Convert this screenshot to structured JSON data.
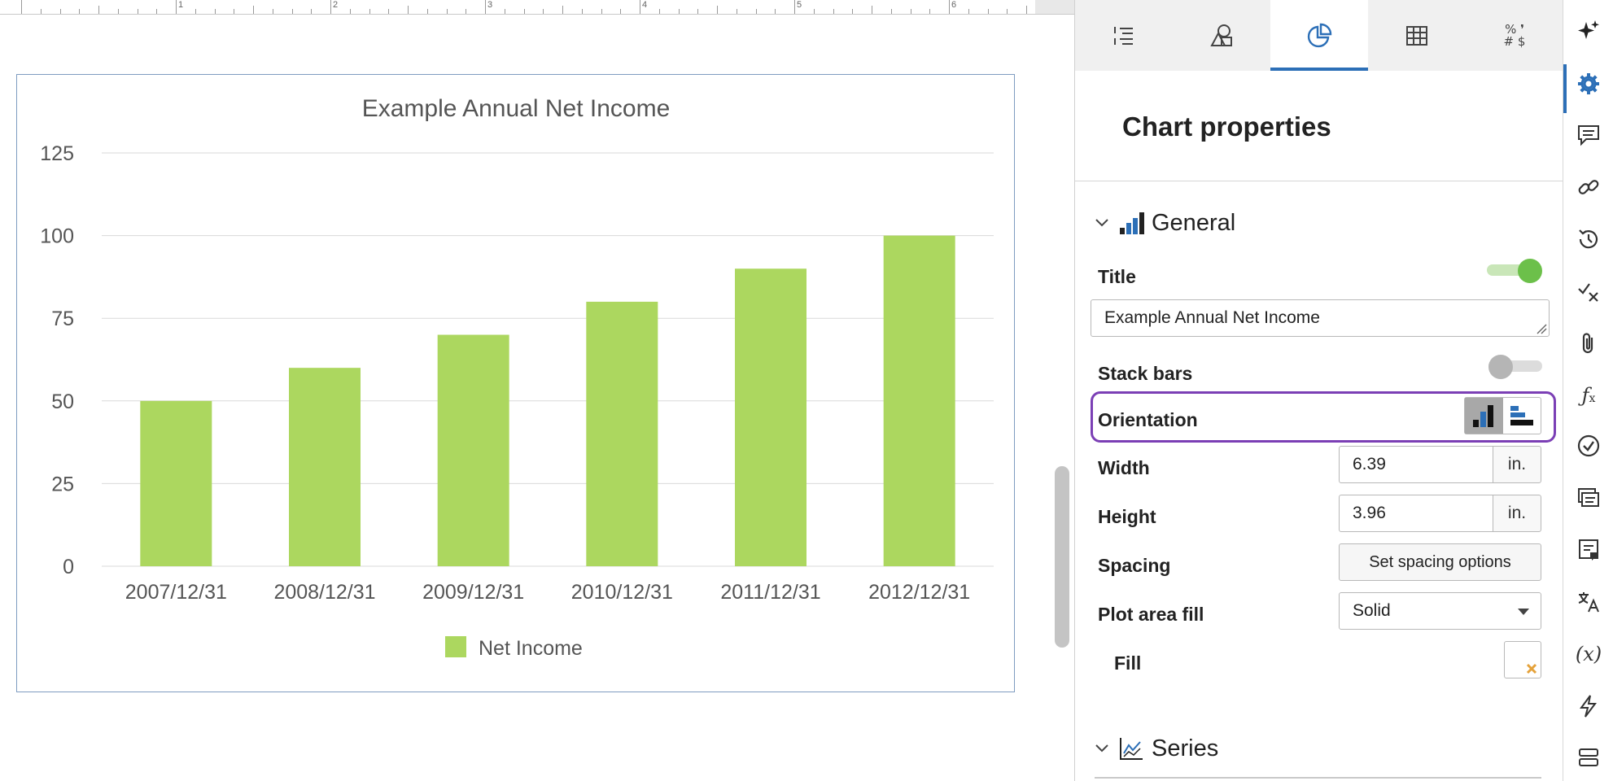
{
  "ruler": {
    "numbers": [
      "1",
      "2",
      "3",
      "4",
      "5",
      "6"
    ]
  },
  "chart_data": {
    "type": "bar",
    "title": "Example Annual Net Income",
    "categories": [
      "2007/12/31",
      "2008/12/31",
      "2009/12/31",
      "2010/12/31",
      "2011/12/31",
      "2012/12/31"
    ],
    "series": [
      {
        "name": "Net Income",
        "values": [
          50,
          60,
          70,
          80,
          90,
          100
        ],
        "color": "#acd75f"
      }
    ],
    "yticks": [
      "0",
      "25",
      "50",
      "75",
      "100",
      "125"
    ],
    "ylim": [
      0,
      125
    ],
    "grid": true,
    "legend_position": "bottom-center"
  },
  "panel": {
    "tabs": [
      {
        "icon": "list-format-icon"
      },
      {
        "icon": "shapes-icon"
      },
      {
        "icon": "pie-chart-icon",
        "active": true
      },
      {
        "icon": "table-icon"
      },
      {
        "icon": "number-format-icon",
        "glyph_top": "% ❜",
        "glyph_bottom": "# $"
      }
    ],
    "title": "Chart properties",
    "general": {
      "label": "General",
      "title_label": "Title",
      "title_value": "Example Annual Net Income",
      "stack_label": "Stack bars",
      "orientation_label": "Orientation",
      "width_label": "Width",
      "width_value": "6.39",
      "height_label": "Height",
      "height_value": "3.96",
      "unit": "in.",
      "spacing_label": "Spacing",
      "spacing_button": "Set spacing options",
      "plot_fill_label": "Plot area fill",
      "plot_fill_value": "Solid",
      "fill_label": "Fill"
    },
    "series": {
      "label": "Series"
    }
  },
  "colors": {
    "accent": "#2c6fb7",
    "highlight": "#7b3fb5",
    "toggle_on": "#6cc04a",
    "bar": "#acd75f"
  }
}
